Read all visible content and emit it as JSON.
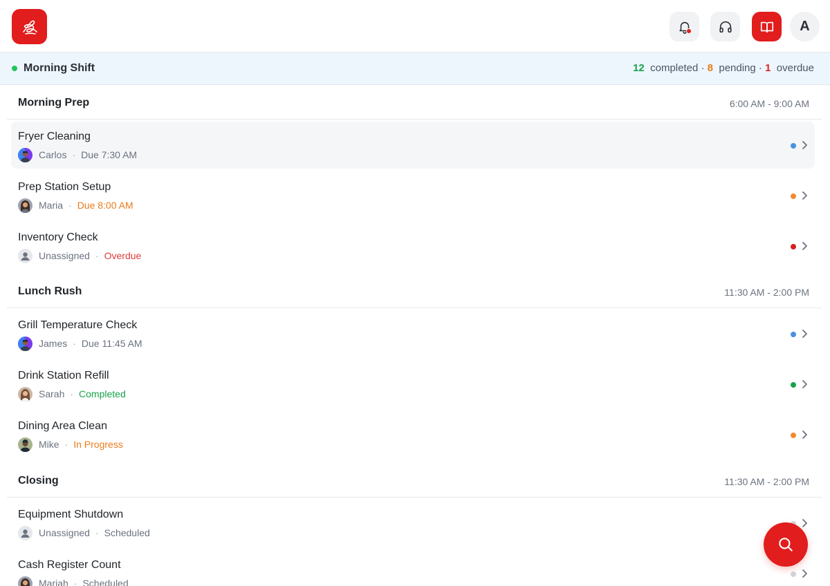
{
  "header": {
    "logo_icon": "signature-logo-icon",
    "notifications_icon": "bell-icon",
    "support_icon": "headphones-icon",
    "guide_icon": "book-open-icon",
    "avatar_initial": "A"
  },
  "shift": {
    "name": "Morning Shift",
    "status_color": "#22c55e",
    "completed_count": "12",
    "completed_label": "completed",
    "pending_count": "8",
    "pending_label": "pending",
    "overdue_count": "1",
    "overdue_label": "overdue",
    "separator": "·"
  },
  "colors": {
    "brand": "#e11d1d",
    "blue": "#4a90e2",
    "orange": "#ef8a30",
    "red": "#d42020",
    "green": "#16a34a",
    "gray": "#d1d5db"
  },
  "sections": [
    {
      "title": "Morning Prep",
      "time": "6:00 AM - 9:00 AM",
      "tasks": [
        {
          "title": "Fryer Cleaning",
          "assignee": "Carlos",
          "detail": "Due 7:30 AM",
          "detail_color": "#6b7280",
          "dot": "#4a90e2",
          "avatar": "photo-1"
        },
        {
          "title": "Prep Station Setup",
          "assignee": "Maria",
          "detail": "Due 8:00 AM",
          "detail_color": "#ea7c1b",
          "dot": "#ef8a30",
          "avatar": "photo-2"
        },
        {
          "title": "Inventory Check",
          "assignee": "Unassigned",
          "detail": "Overdue",
          "detail_color": "#e03b3b",
          "dot": "#d42020",
          "avatar": "unassigned"
        }
      ]
    },
    {
      "title": "Lunch Rush",
      "time": "11:30 AM - 2:00 PM",
      "tasks": [
        {
          "title": "Grill Temperature Check",
          "assignee": "James",
          "detail": "Due 11:45 AM",
          "detail_color": "#6b7280",
          "dot": "#4a90e2",
          "avatar": "photo-1"
        },
        {
          "title": "Drink Station Refill",
          "assignee": "Sarah",
          "detail": "Completed",
          "detail_color": "#16a34a",
          "dot": "#16a34a",
          "avatar": "photo-3"
        },
        {
          "title": "Dining Area Clean",
          "assignee": "Mike",
          "detail": "In Progress",
          "detail_color": "#ea7c1b",
          "dot": "#ef8a30",
          "avatar": "photo-4"
        }
      ]
    },
    {
      "title": "Closing",
      "time": "11:30 AM - 2:00 PM",
      "tasks": [
        {
          "title": "Equipment Shutdown",
          "assignee": "Unassigned",
          "detail": "Scheduled",
          "detail_color": "#6b7280",
          "dot": "#d1d5db",
          "avatar": "unassigned"
        },
        {
          "title": "Cash Register Count",
          "assignee": "Mariah",
          "detail": "Scheduled",
          "detail_color": "#6b7280",
          "dot": "#d1d5db",
          "avatar": "photo-2"
        }
      ]
    }
  ],
  "fab": {
    "icon": "search-icon"
  }
}
